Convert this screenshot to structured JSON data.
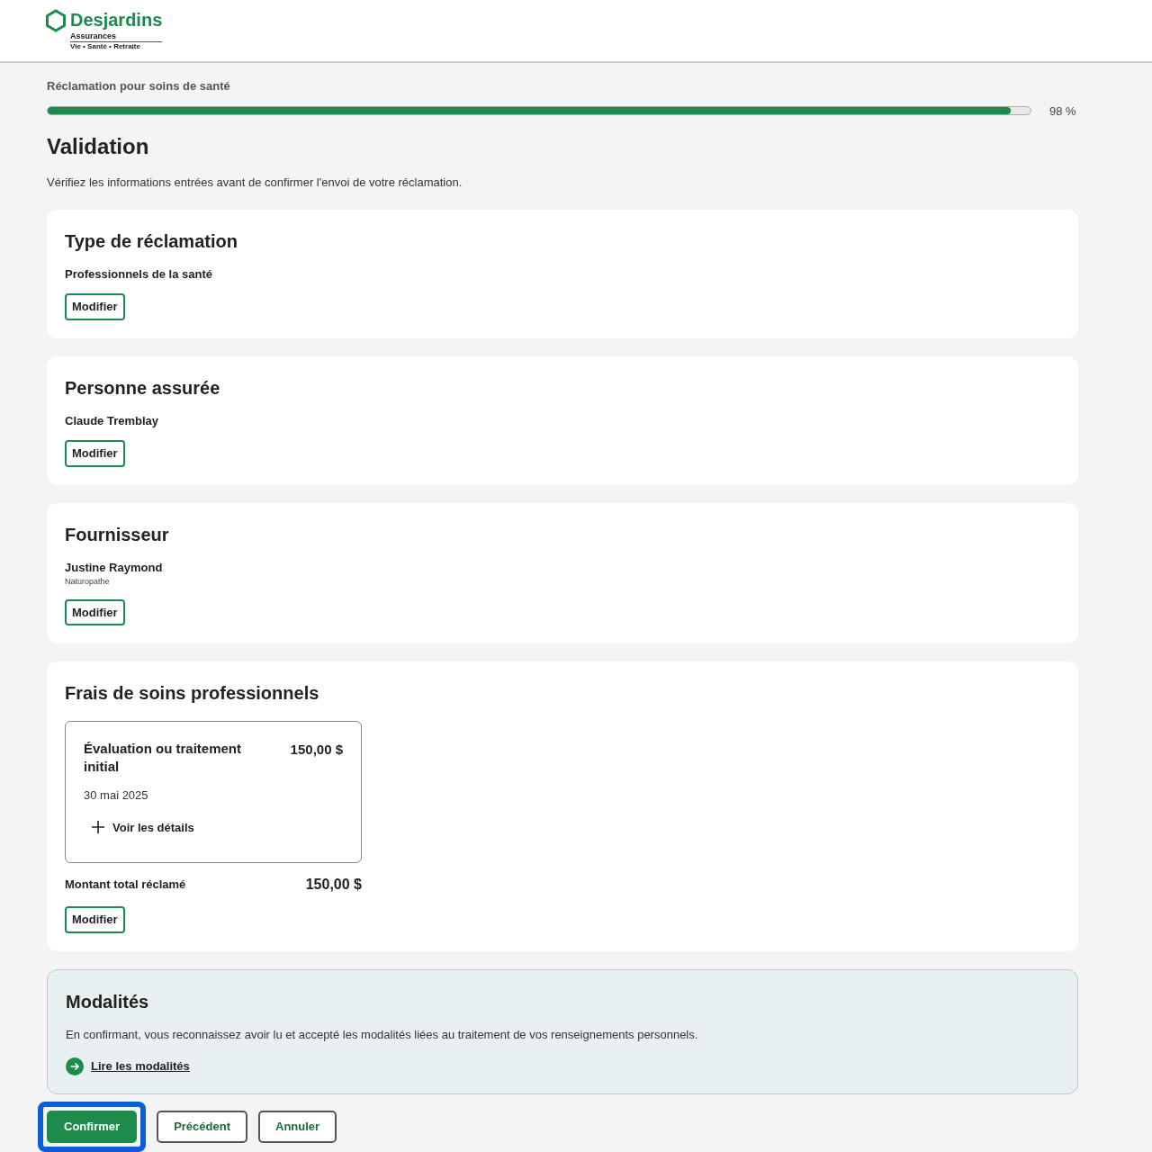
{
  "logo": {
    "name": "Desjardins",
    "line1": "Assurances",
    "line2": "Vie • Santé • Retraite"
  },
  "progress": {
    "label": "Réclamation pour soins de santé",
    "level": 0.98,
    "reading": "98 %"
  },
  "title": "Validation",
  "intro": "Vérifiez les informations entrées avant de confirmer l'envoi de votre réclamation.",
  "sections": [
    {
      "title": "Type de réclamation",
      "value": "Professionnels de la santé",
      "button": "Modifier"
    },
    {
      "title": "Personne assurée",
      "value": "Claude Tremblay",
      "button": "Modifier"
    },
    {
      "title": "Fournisseur",
      "value": "Justine Raymond",
      "subvalue": "Naturopathe",
      "button": "Modifier"
    },
    {
      "title": "Frais de soins professionnels",
      "fee": {
        "name": "Évaluation ou traitement initial",
        "amount": "150,00 $",
        "date": "30 mai 2025",
        "details": "Voir les détails"
      },
      "total_label": "Montant total réclamé",
      "total": "150,00 $",
      "button": "Modifier"
    }
  ],
  "terms": {
    "title": "Modalités",
    "text": "En confirmant, vous reconnaissez avoir lu et accepté les modalités liées au traitement de vos renseignements personnels.",
    "link": "Lire les modalités"
  },
  "actions": [
    {
      "label": "Confirmer",
      "kind": "primary",
      "focused": true
    },
    {
      "label": "Précédent",
      "kind": "secondary",
      "focused": false
    },
    {
      "label": "Annuler",
      "kind": "secondary",
      "focused": false
    }
  ]
}
